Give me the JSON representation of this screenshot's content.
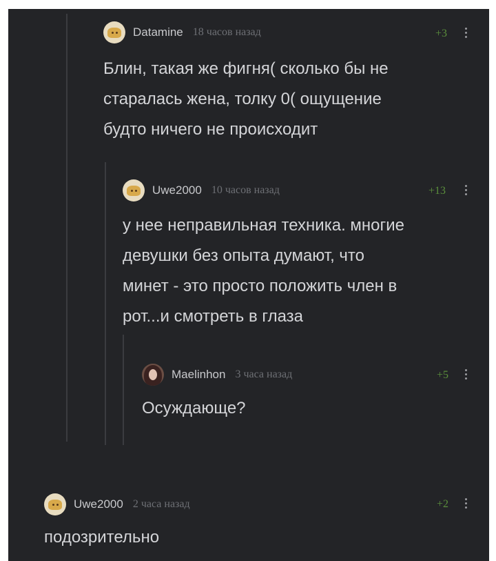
{
  "comments": [
    {
      "username": "Datamine",
      "time": "18 часов назад",
      "rating": "+3",
      "text": "Блин, такая же фигня( сколько бы не\nстаралась жена, толку 0( ощущение\nбудто ничего не происходит",
      "avatar": "pie-avatar-icon"
    },
    {
      "username": "Uwe2000",
      "time": "10 часов назад",
      "rating": "+13",
      "text": "у нее неправильная техника. многие\nдевушки без опыта думают, что\nминет - это просто положить член в\nрот...и смотреть в глаза",
      "avatar": "pie-avatar-icon"
    },
    {
      "username": "Maelinhon",
      "time": "3 часа назад",
      "rating": "+5",
      "text": "Осуждающе?",
      "avatar": "photo-avatar"
    },
    {
      "username": "Uwe2000",
      "time": "2 часа назад",
      "rating": "+2",
      "text": "подозрительно",
      "avatar": "pie-avatar-icon"
    }
  ],
  "colors": {
    "background": "#232427",
    "text": "#d4d5d8",
    "meta": "#6e7075",
    "rating": "#5b8f3c",
    "thread_line": "#3b3c40"
  }
}
